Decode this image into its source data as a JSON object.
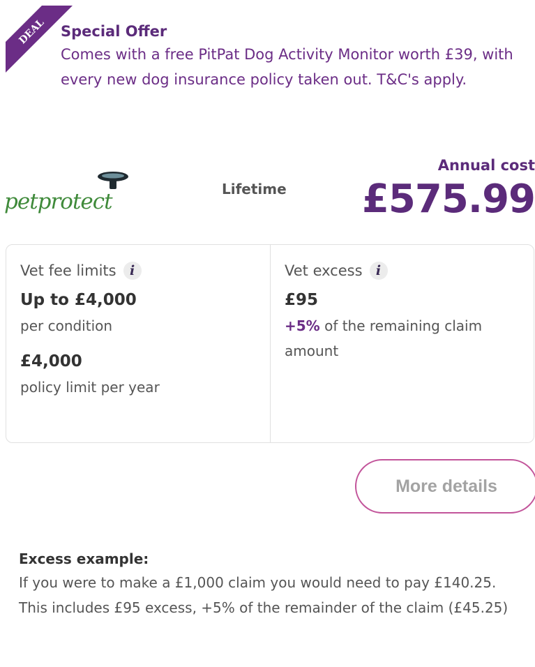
{
  "deal": {
    "ribbon_label": "DEAL",
    "ribbon_color": "#6b2d86"
  },
  "offer": {
    "title": "Special Offer",
    "text": "Comes with a free PitPat Dog Activity Monitor worth £39, with every new dog insurance policy taken out. T&C's apply."
  },
  "provider": {
    "logo_text": "petprotect",
    "policy_type": "Lifetime"
  },
  "price": {
    "label": "Annual cost",
    "value": "£575.99"
  },
  "vet_fee": {
    "label": "Vet fee limits",
    "info_icon": "i",
    "amount1": "Up to £4,000",
    "desc1": "per condition",
    "amount2": "£4,000",
    "desc2": "policy limit per year"
  },
  "vet_excess": {
    "label": "Vet excess",
    "info_icon": "i",
    "amount": "£95",
    "extra_highlight": "+5%",
    "extra_text": " of the remaining claim amount"
  },
  "actions": {
    "more_details": "More details"
  },
  "example": {
    "title": "Excess example:",
    "text": "If you were to make a £1,000 claim you would need to pay £140.25. This includes £95 excess, +5% of the remainder of the claim (£45.25)"
  },
  "colors": {
    "accent": "#5b2b7a",
    "button_border": "#c2549a",
    "logo_green": "#3f8a3a"
  }
}
